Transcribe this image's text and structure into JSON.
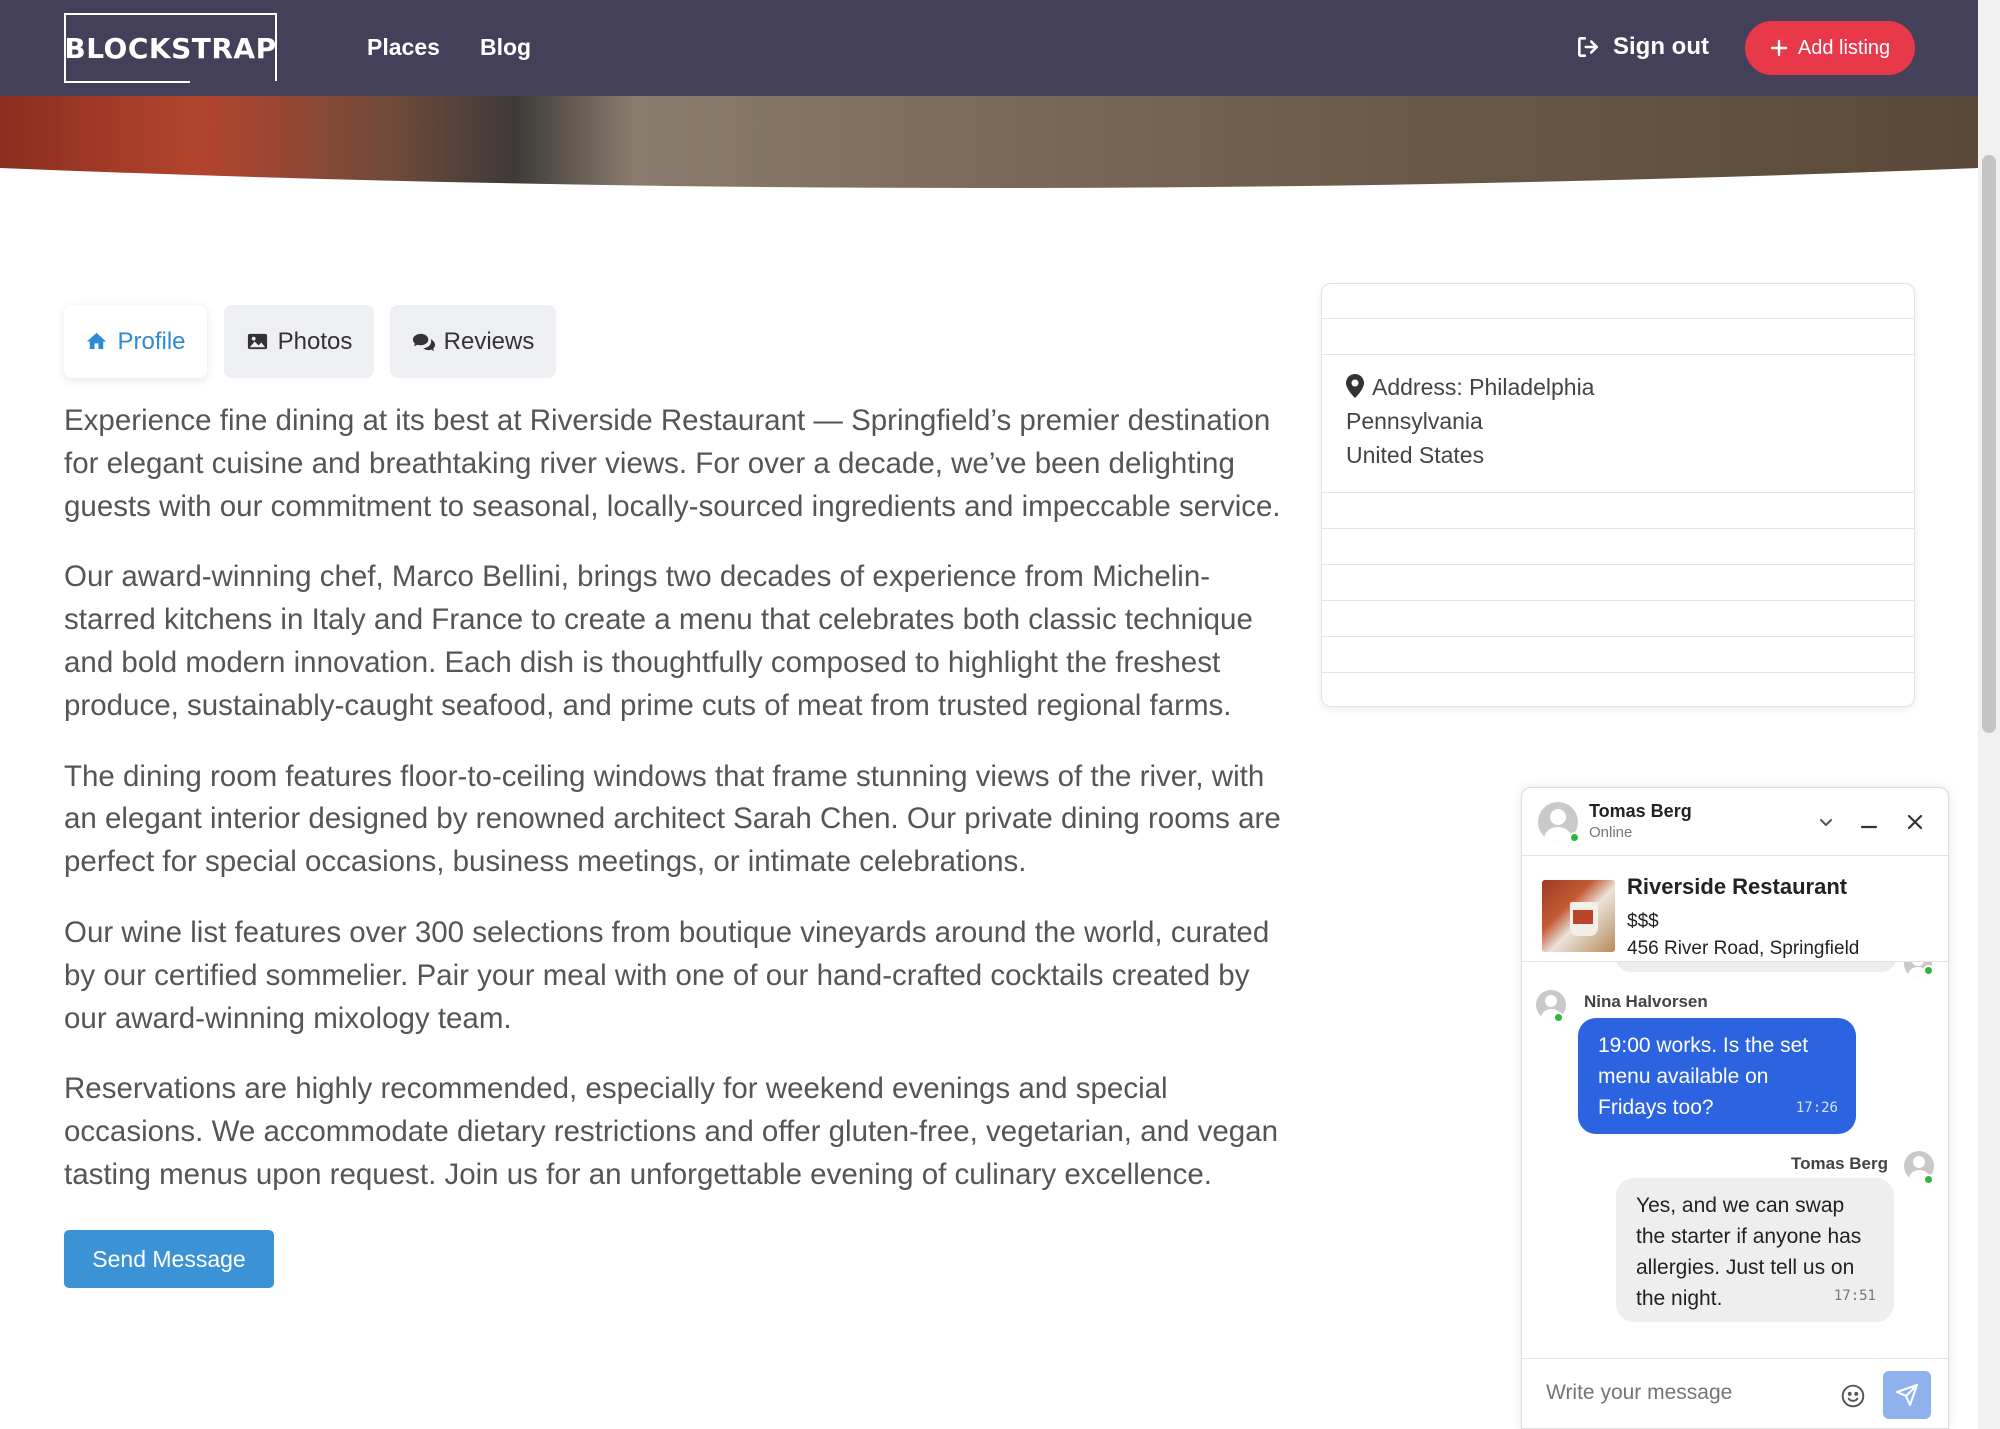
{
  "nav": {
    "brand": "BLOCKSTRAP",
    "links": [
      "Places",
      "Blog"
    ],
    "signout": "Sign out",
    "add_listing": "Add listing"
  },
  "tabs": [
    {
      "label": "Profile",
      "icon": "home-icon",
      "active": true
    },
    {
      "label": "Photos",
      "icon": "image-icon",
      "active": false
    },
    {
      "label": "Reviews",
      "icon": "comments-icon",
      "active": false
    }
  ],
  "description": [
    "Experience fine dining at its best at Riverside Restaurant — Springfield’s premier destination for elegant cuisine and breathtaking river views. For over a decade, we’ve been delighting guests with our commitment to seasonal, locally-sourced ingredients and impeccable service.",
    "Our award-winning chef, Marco Bellini, brings two decades of experience from Michelin-starred kitchens in Italy and France to create a menu that celebrates both classic technique and bold modern innovation. Each dish is thoughtfully composed to highlight the freshest produce, sustainably-caught seafood, and prime cuts of meat from trusted regional farms.",
    "The dining room features floor-to-ceiling windows that frame stunning views of the river, with an elegant interior designed by renowned architect Sarah Chen. Our private dining rooms are perfect for special occasions, business meetings, or intimate celebrations.",
    "Our wine list features over 300 selections from boutique vineyards around the world, curated by our certified sommelier. Pair your meal with one of our hand-crafted cocktails created by our award-winning mixology team.",
    "Reservations are highly recommended, especially for weekend evenings and special occasions. We accommodate dietary restrictions and offer gluten-free, vegetarian, and vegan tasting menus upon request. Join us for an unforgettable evening of culinary excellence."
  ],
  "send_message": "Send Message",
  "info": {
    "address_line1": "Address: Philadelphia",
    "address_line2": "Pennsylvania",
    "address_line3": "United States"
  },
  "chat": {
    "contact_name": "Tomas Berg",
    "contact_status": "Online",
    "listing": {
      "name": "Riverside Restaurant",
      "price": "$$$",
      "address": "456 River Road, Springfield"
    },
    "messages": [
      {
        "sender": "Nina Halvorsen",
        "text": "19:00 works. Is the set menu available on Fridays too?",
        "time": "17:26",
        "direction": "in"
      },
      {
        "sender": "Tomas Berg",
        "text": "Yes, and we can swap the starter if anyone has allergies. Just tell us on the night.",
        "time": "17:51",
        "direction": "out"
      }
    ],
    "input_placeholder": "Write your message"
  },
  "colors": {
    "navbar": "#45405a",
    "accent_red": "#e8394a",
    "tab_active": "#2e89d6",
    "send_button": "#3b93d6",
    "bubble_in": "#2b63e0",
    "online": "#2fb344"
  }
}
